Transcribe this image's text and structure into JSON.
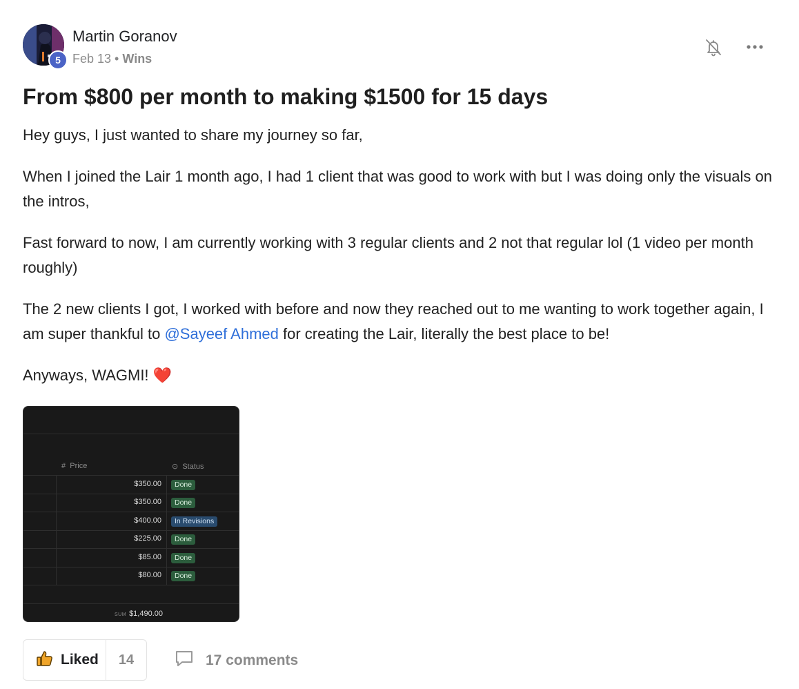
{
  "post": {
    "author": "Martin Goranov",
    "level": "5",
    "date": "Feb 13",
    "separator": " • ",
    "category": "Wins",
    "title": "From $800 per month to making $1500 for 15 days",
    "paragraphs": {
      "p1": "Hey guys, I just wanted to share my journey so far,",
      "p2": "When I joined the Lair 1 month ago, I had 1 client that was good to work with but I was doing only the visuals on the intros,",
      "p3": "Fast forward to now, I am currently working with 3 regular clients and 2 not that regular lol (1 video per month roughly)",
      "p4_before": "The 2 new clients I got, I worked with before and now they reached out to me wanting to work together again, I am super thankful to ",
      "p4_mention": "@Sayeef Ahmed",
      "p4_after": " for creating the Lair, literally the best place to be!",
      "p5": "Anyways, WAGMI! ❤️"
    }
  },
  "attachment": {
    "price_header": "Price",
    "status_header": "Status",
    "rows": [
      {
        "price": "$350.00",
        "status": "Done"
      },
      {
        "price": "$350.00",
        "status": "Done"
      },
      {
        "price": "$400.00",
        "status": "In Revisions"
      },
      {
        "price": "$225.00",
        "status": "Done"
      },
      {
        "price": "$85.00",
        "status": "Done"
      },
      {
        "price": "$80.00",
        "status": "Done"
      }
    ],
    "sum_label": "SUM",
    "sum_value": "$1,490.00"
  },
  "actions": {
    "like_label": "Liked",
    "like_count": "14",
    "comments_label": "17 comments"
  },
  "icons": {
    "bell": "bell-off-icon",
    "more": "more-horizontal-icon",
    "thumb": "thumbs-up-icon",
    "comment": "comment-bubble-icon"
  },
  "colors": {
    "mention": "#2f6fd9",
    "badge": "#4b63c6",
    "tag_done": "#2c5d3d",
    "tag_revisions": "#294b6e",
    "thumb": "#f0a52a"
  }
}
